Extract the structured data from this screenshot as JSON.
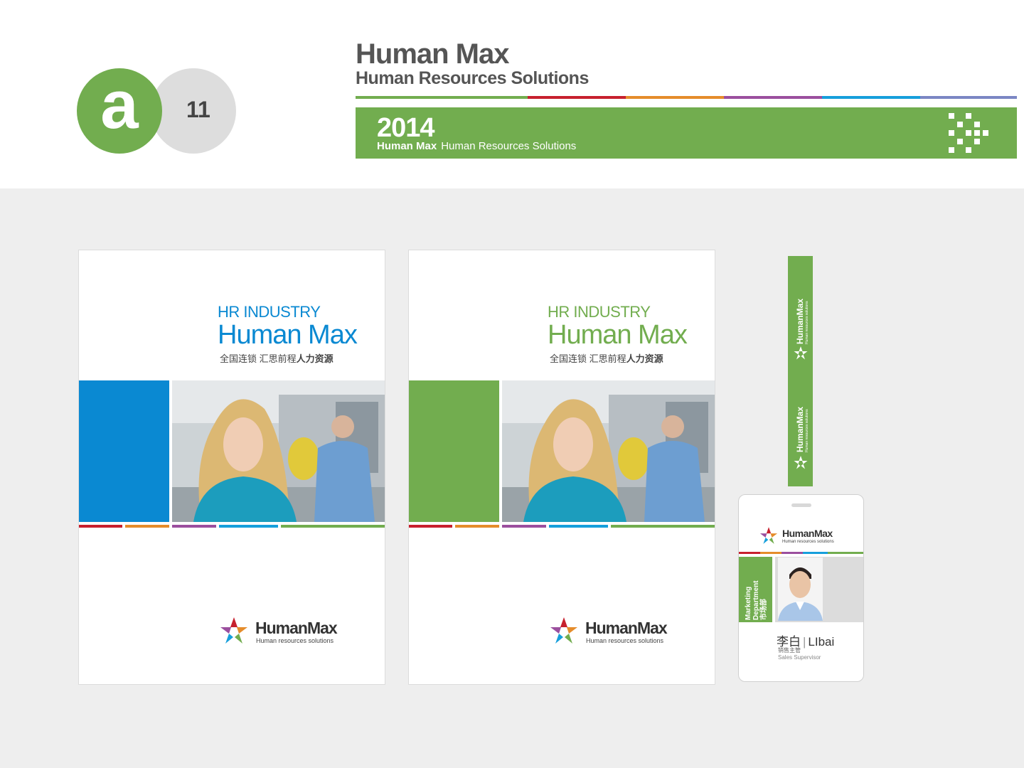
{
  "header": {
    "badge_letter": "a",
    "page_number": "11",
    "title": "Human Max",
    "subtitle": "Human Resources Solutions",
    "banner": {
      "year": "2014",
      "brand": "Human Max",
      "tagline": "Human Resources Solutions"
    }
  },
  "colors": {
    "green": "#72ad4f",
    "blue": "#0a89d2",
    "red": "#c7202e",
    "orange": "#e58c2b",
    "purple": "#9b4f9e",
    "light_blue": "#169fdc",
    "grey_circle": "#dddddd"
  },
  "covers": [
    {
      "variant": "blue",
      "heading": "HR INDUSTRY",
      "brand": "Human Max",
      "slogan_regular": "全国连锁 汇思前程",
      "slogan_bold": "人力资源",
      "logo_name": "HumanMax",
      "logo_tagline": "Human resources solutions"
    },
    {
      "variant": "green",
      "heading": "HR INDUSTRY",
      "brand": "Human Max",
      "slogan_regular": "全国连锁 汇思前程",
      "slogan_bold": "人力资源",
      "logo_name": "HumanMax",
      "logo_tagline": "Human resources solutions"
    }
  ],
  "lanyard": {
    "name": "HumanMax",
    "tagline": "Human resources solutions"
  },
  "badge": {
    "logo_name": "HumanMax",
    "logo_tagline": "Human resources solutions",
    "department_en_1": "Marketing",
    "department_en_2": "Department",
    "department_cn": "市场部",
    "name_cn": "李白",
    "name_en": "LIbai",
    "title_cn": "销售主管",
    "title_en": "Sales Supervisor"
  }
}
